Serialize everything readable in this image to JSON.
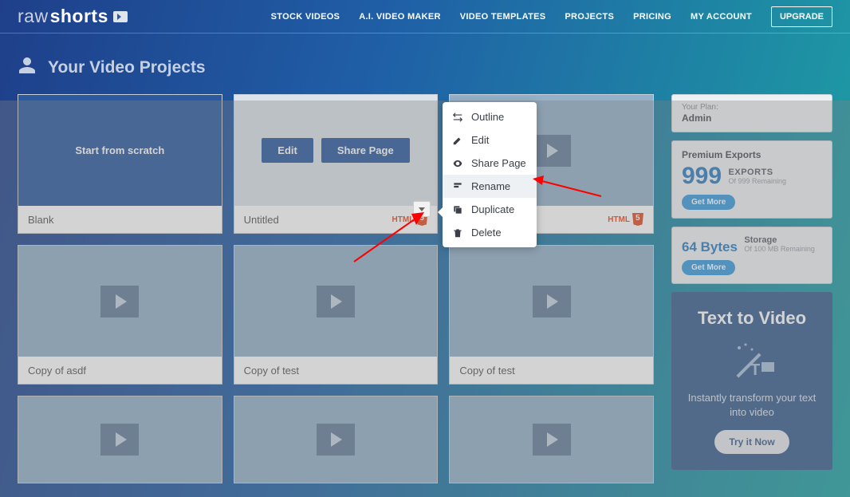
{
  "logo": {
    "part1": "raw",
    "part2": "shorts"
  },
  "nav": {
    "items": [
      "STOCK VIDEOS",
      "A.I. VIDEO MAKER",
      "VIDEO TEMPLATES",
      "PROJECTS",
      "PRICING",
      "MY ACCOUNT"
    ],
    "upgrade": "UPGRADE"
  },
  "page_title": "Your Video Projects",
  "blank": {
    "label": "Start from scratch",
    "caption": "Blank"
  },
  "hover": {
    "edit": "Edit",
    "share": "Share Page",
    "caption": "Untitled",
    "badge": "HTML"
  },
  "cards": [
    {
      "caption": "",
      "badge": "HTML"
    },
    {
      "caption": "Copy of asdf"
    },
    {
      "caption": "Copy of test"
    },
    {
      "caption": "Copy of test"
    },
    {
      "caption": ""
    },
    {
      "caption": ""
    },
    {
      "caption": ""
    }
  ],
  "menu": {
    "items": [
      "Outline",
      "Edit",
      "Share Page",
      "Rename",
      "Duplicate",
      "Delete"
    ]
  },
  "sidebar": {
    "plan_label": "Your Plan:",
    "plan": "Admin",
    "premium_title": "Premium Exports",
    "premium_num": "999",
    "premium_unit": "EXPORTS",
    "premium_sub": "Of 999 Remaining",
    "getmore": "Get More",
    "storage_num": "64 Bytes",
    "storage_unit": "Storage",
    "storage_sub": "Of 100 MB Remaining",
    "ttv_title": "Text to Video",
    "ttv_sub": "Instantly transform your text into video",
    "ttv_btn": "Try it Now"
  }
}
